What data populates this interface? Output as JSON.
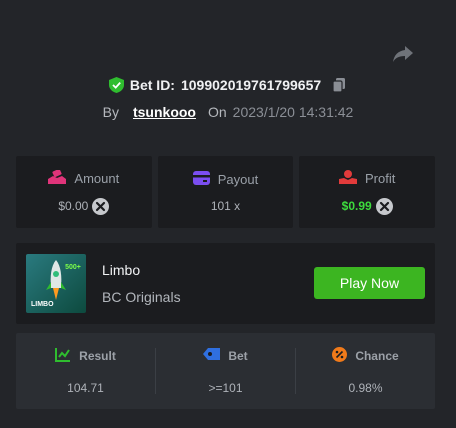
{
  "header": {
    "bet_id_label": "Bet ID:",
    "bet_id": "109902019761799657",
    "by_label": "By",
    "username": "tsunkooo",
    "on_label": "On",
    "datetime": "2023/1/20 14:31:42"
  },
  "stats": {
    "amount": {
      "label": "Amount",
      "value": "$0.00",
      "icon": "amount-icon"
    },
    "payout": {
      "label": "Payout",
      "value": "101 x",
      "icon": "wallet-icon"
    },
    "profit": {
      "label": "Profit",
      "value": "$0.99",
      "icon": "profit-icon"
    }
  },
  "game": {
    "name": "Limbo",
    "provider": "BC Originals",
    "play_label": "Play Now",
    "thumb_badge": "500+",
    "thumb_title": "LIMBO"
  },
  "details": {
    "result": {
      "label": "Result",
      "value": "104.71"
    },
    "bet": {
      "label": "Bet",
      "value": ">=101"
    },
    "chance": {
      "label": "Chance",
      "value": "0.98%"
    }
  },
  "colors": {
    "background": "#232529",
    "panel": "#1b1c1f",
    "accent_green": "#3cb521",
    "profit_green": "#3ddc3d"
  }
}
